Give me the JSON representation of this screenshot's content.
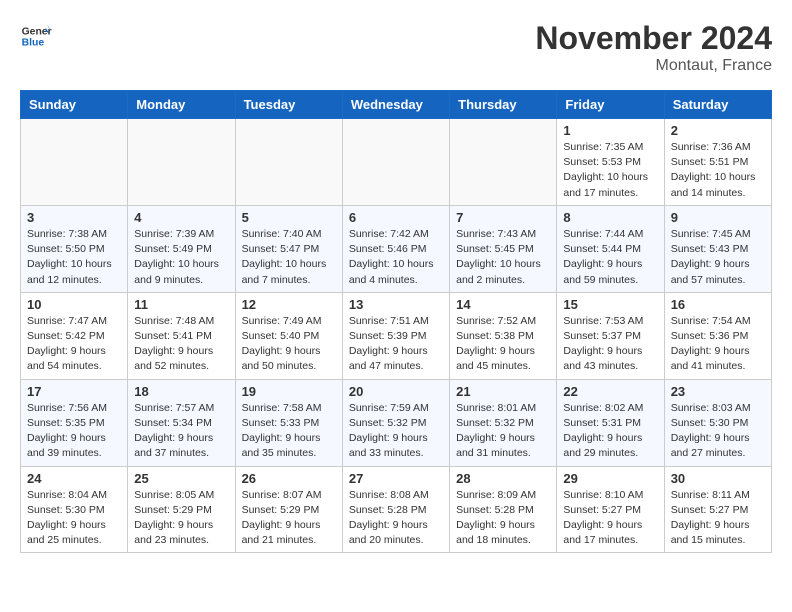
{
  "header": {
    "logo_line1": "General",
    "logo_line2": "Blue",
    "month_title": "November 2024",
    "location": "Montaut, France"
  },
  "weekdays": [
    "Sunday",
    "Monday",
    "Tuesday",
    "Wednesday",
    "Thursday",
    "Friday",
    "Saturday"
  ],
  "weeks": [
    [
      {
        "day": "",
        "info": ""
      },
      {
        "day": "",
        "info": ""
      },
      {
        "day": "",
        "info": ""
      },
      {
        "day": "",
        "info": ""
      },
      {
        "day": "",
        "info": ""
      },
      {
        "day": "1",
        "info": "Sunrise: 7:35 AM\nSunset: 5:53 PM\nDaylight: 10 hours\nand 17 minutes."
      },
      {
        "day": "2",
        "info": "Sunrise: 7:36 AM\nSunset: 5:51 PM\nDaylight: 10 hours\nand 14 minutes."
      }
    ],
    [
      {
        "day": "3",
        "info": "Sunrise: 7:38 AM\nSunset: 5:50 PM\nDaylight: 10 hours\nand 12 minutes."
      },
      {
        "day": "4",
        "info": "Sunrise: 7:39 AM\nSunset: 5:49 PM\nDaylight: 10 hours\nand 9 minutes."
      },
      {
        "day": "5",
        "info": "Sunrise: 7:40 AM\nSunset: 5:47 PM\nDaylight: 10 hours\nand 7 minutes."
      },
      {
        "day": "6",
        "info": "Sunrise: 7:42 AM\nSunset: 5:46 PM\nDaylight: 10 hours\nand 4 minutes."
      },
      {
        "day": "7",
        "info": "Sunrise: 7:43 AM\nSunset: 5:45 PM\nDaylight: 10 hours\nand 2 minutes."
      },
      {
        "day": "8",
        "info": "Sunrise: 7:44 AM\nSunset: 5:44 PM\nDaylight: 9 hours\nand 59 minutes."
      },
      {
        "day": "9",
        "info": "Sunrise: 7:45 AM\nSunset: 5:43 PM\nDaylight: 9 hours\nand 57 minutes."
      }
    ],
    [
      {
        "day": "10",
        "info": "Sunrise: 7:47 AM\nSunset: 5:42 PM\nDaylight: 9 hours\nand 54 minutes."
      },
      {
        "day": "11",
        "info": "Sunrise: 7:48 AM\nSunset: 5:41 PM\nDaylight: 9 hours\nand 52 minutes."
      },
      {
        "day": "12",
        "info": "Sunrise: 7:49 AM\nSunset: 5:40 PM\nDaylight: 9 hours\nand 50 minutes."
      },
      {
        "day": "13",
        "info": "Sunrise: 7:51 AM\nSunset: 5:39 PM\nDaylight: 9 hours\nand 47 minutes."
      },
      {
        "day": "14",
        "info": "Sunrise: 7:52 AM\nSunset: 5:38 PM\nDaylight: 9 hours\nand 45 minutes."
      },
      {
        "day": "15",
        "info": "Sunrise: 7:53 AM\nSunset: 5:37 PM\nDaylight: 9 hours\nand 43 minutes."
      },
      {
        "day": "16",
        "info": "Sunrise: 7:54 AM\nSunset: 5:36 PM\nDaylight: 9 hours\nand 41 minutes."
      }
    ],
    [
      {
        "day": "17",
        "info": "Sunrise: 7:56 AM\nSunset: 5:35 PM\nDaylight: 9 hours\nand 39 minutes."
      },
      {
        "day": "18",
        "info": "Sunrise: 7:57 AM\nSunset: 5:34 PM\nDaylight: 9 hours\nand 37 minutes."
      },
      {
        "day": "19",
        "info": "Sunrise: 7:58 AM\nSunset: 5:33 PM\nDaylight: 9 hours\nand 35 minutes."
      },
      {
        "day": "20",
        "info": "Sunrise: 7:59 AM\nSunset: 5:32 PM\nDaylight: 9 hours\nand 33 minutes."
      },
      {
        "day": "21",
        "info": "Sunrise: 8:01 AM\nSunset: 5:32 PM\nDaylight: 9 hours\nand 31 minutes."
      },
      {
        "day": "22",
        "info": "Sunrise: 8:02 AM\nSunset: 5:31 PM\nDaylight: 9 hours\nand 29 minutes."
      },
      {
        "day": "23",
        "info": "Sunrise: 8:03 AM\nSunset: 5:30 PM\nDaylight: 9 hours\nand 27 minutes."
      }
    ],
    [
      {
        "day": "24",
        "info": "Sunrise: 8:04 AM\nSunset: 5:30 PM\nDaylight: 9 hours\nand 25 minutes."
      },
      {
        "day": "25",
        "info": "Sunrise: 8:05 AM\nSunset: 5:29 PM\nDaylight: 9 hours\nand 23 minutes."
      },
      {
        "day": "26",
        "info": "Sunrise: 8:07 AM\nSunset: 5:29 PM\nDaylight: 9 hours\nand 21 minutes."
      },
      {
        "day": "27",
        "info": "Sunrise: 8:08 AM\nSunset: 5:28 PM\nDaylight: 9 hours\nand 20 minutes."
      },
      {
        "day": "28",
        "info": "Sunrise: 8:09 AM\nSunset: 5:28 PM\nDaylight: 9 hours\nand 18 minutes."
      },
      {
        "day": "29",
        "info": "Sunrise: 8:10 AM\nSunset: 5:27 PM\nDaylight: 9 hours\nand 17 minutes."
      },
      {
        "day": "30",
        "info": "Sunrise: 8:11 AM\nSunset: 5:27 PM\nDaylight: 9 hours\nand 15 minutes."
      }
    ]
  ]
}
